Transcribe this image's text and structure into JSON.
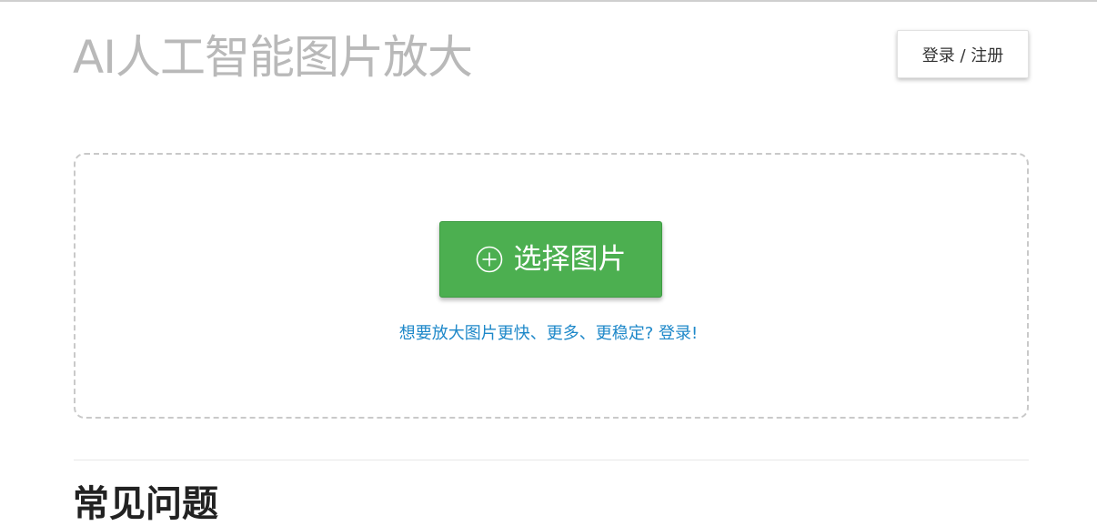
{
  "header": {
    "title": "AI人工智能图片放大",
    "login_label": "登录 / 注册"
  },
  "upload": {
    "select_label": "选择图片",
    "select_icon": "plus-circle-icon",
    "login_prompt": "想要放大图片更快、更多、更稳定? 登录!"
  },
  "section": {
    "heading": "常见问题"
  },
  "colors": {
    "accent_green": "#4caf50",
    "link_blue": "#1e88c9",
    "title_gray": "#b9b9b9"
  }
}
